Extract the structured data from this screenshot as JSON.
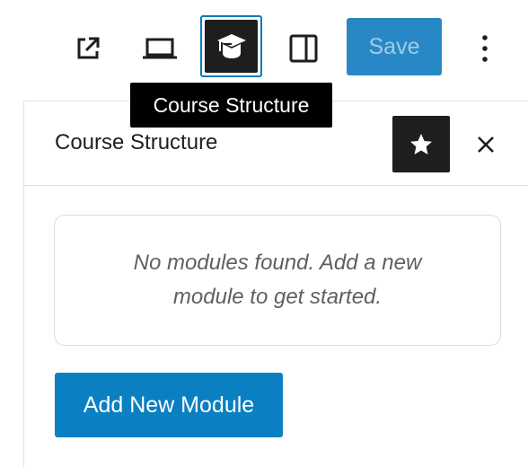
{
  "toolbar": {
    "view_icon": "external-link-icon",
    "preview_icon": "laptop-icon",
    "course_icon": "graduation-cap-icon",
    "settings_icon": "sidebar-panel-icon",
    "save_label": "Save",
    "more_icon": "vertical-ellipsis-icon"
  },
  "tooltip": {
    "text": "Course Structure"
  },
  "panel": {
    "title": "Course Structure",
    "star_icon": "star-icon",
    "close_icon": "close-icon",
    "empty_message": "No modules found. Add a new module to get started.",
    "add_button_label": "Add New Module"
  },
  "colors": {
    "accent": "#007cba",
    "save_bg": "#2888c5",
    "add_button_bg": "#0a7fc2",
    "dark": "#1e1e1e"
  }
}
